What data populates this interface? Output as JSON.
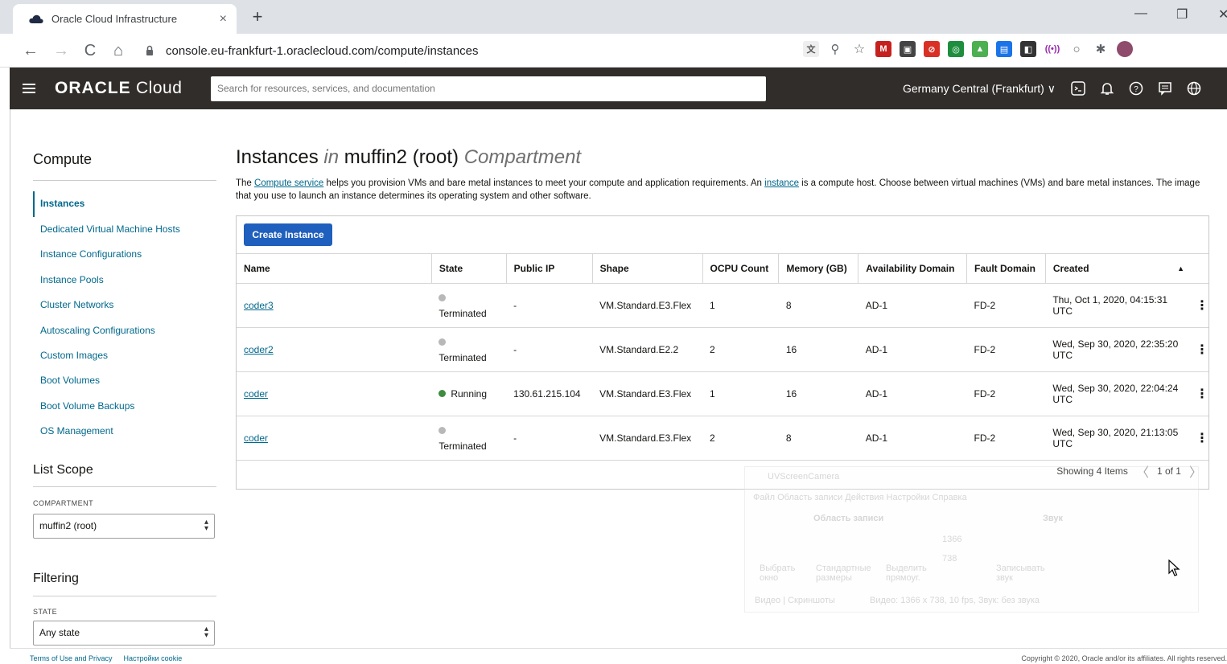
{
  "browser": {
    "tab_title": "Oracle Cloud Infrastructure",
    "tab_close": "×",
    "new_tab": "+",
    "url": "console.eu-frankfurt-1.oraclecloud.com/compute/instances",
    "minimize": "—",
    "restore": "❐",
    "close": "✕",
    "back": "←",
    "forward": "→",
    "reload": "C",
    "home": "⌂"
  },
  "header": {
    "brand_bold": "ORACLE",
    "brand_light": " Cloud",
    "search_placeholder": "Search for resources, services, and documentation",
    "region": "Germany Central (Frankfurt) ∨"
  },
  "sidebar": {
    "title": "Compute",
    "items": [
      {
        "label": "Instances",
        "active": true
      },
      {
        "label": "Dedicated Virtual Machine Hosts"
      },
      {
        "label": "Instance Configurations"
      },
      {
        "label": "Instance Pools"
      },
      {
        "label": "Cluster Networks"
      },
      {
        "label": "Autoscaling Configurations"
      },
      {
        "label": "Custom Images"
      },
      {
        "label": "Boot Volumes"
      },
      {
        "label": "Boot Volume Backups"
      },
      {
        "label": "OS Management"
      }
    ],
    "list_scope_title": "List Scope",
    "compartment_label": "COMPARTMENT",
    "compartment_value": "muffin2 (root)",
    "filtering_title": "Filtering",
    "state_label": "STATE",
    "state_value": "Any state"
  },
  "main": {
    "title_a": "Instances ",
    "title_in": "in",
    "title_b": " muffin2 (root) ",
    "title_c": "Compartment",
    "desc_1": "The ",
    "desc_link1": "Compute service",
    "desc_2": " helps you provision VMs and bare metal instances to meet your compute and application requirements. An ",
    "desc_link2": "instance",
    "desc_3": " is a compute host. Choose between virtual machines (VMs) and bare metal instances. The image that you use to launch an instance determines its operating system and other software.",
    "create_button": "Create Instance",
    "columns": [
      "Name",
      "State",
      "Public IP",
      "Shape",
      "OCPU Count",
      "Memory (GB)",
      "Availability Domain",
      "Fault Domain",
      "Created"
    ],
    "rows": [
      {
        "name": "coder3",
        "state": "Terminated",
        "ip": "-",
        "shape": "VM.Standard.E3.Flex",
        "ocpu": "1",
        "mem": "8",
        "ad": "AD-1",
        "fd": "FD-2",
        "created": "Thu, Oct 1, 2020, 04:15:31 UTC"
      },
      {
        "name": "coder2",
        "state": "Terminated",
        "ip": "-",
        "shape": "VM.Standard.E2.2",
        "ocpu": "2",
        "mem": "16",
        "ad": "AD-1",
        "fd": "FD-2",
        "created": "Wed, Sep 30, 2020, 22:35:20 UTC"
      },
      {
        "name": "coder",
        "state": "Running",
        "ip": "130.61.215.104",
        "shape": "VM.Standard.E3.Flex",
        "ocpu": "1",
        "mem": "16",
        "ad": "AD-1",
        "fd": "FD-2",
        "created": "Wed, Sep 30, 2020, 22:04:24 UTC"
      },
      {
        "name": "coder",
        "state": "Terminated",
        "ip": "-",
        "shape": "VM.Standard.E3.Flex",
        "ocpu": "2",
        "mem": "8",
        "ad": "AD-1",
        "fd": "FD-2",
        "created": "Wed, Sep 30, 2020, 21:13:05 UTC"
      }
    ],
    "showing": "Showing 4 Items",
    "page": "1 of 1",
    "kebab": "⋮",
    "sort": "▲",
    "prev": "〈",
    "next": "〉"
  },
  "ghost": {
    "app": "UVScreenCamera",
    "menu": "Файл   Область записи   Действия   Настройки   Справка",
    "section1": "Область записи",
    "section2": "Звук",
    "w": "1366",
    "h": "738",
    "btn1": "Выбрать окно",
    "btn2": "Стандартные размеры",
    "btn3": "Выделить прямоуг.",
    "btn4": "Записывать звук",
    "tabs": "Видео | Скриншоты",
    "status": "Видео: 1366 x 738, 10 fps, Звук: без звука"
  },
  "footer": {
    "terms": "Terms of Use and Privacy",
    "cookie": "Настройки cookie",
    "copyright": "Copyright © 2020, Oracle and/or its affiliates. All rights reserved."
  }
}
